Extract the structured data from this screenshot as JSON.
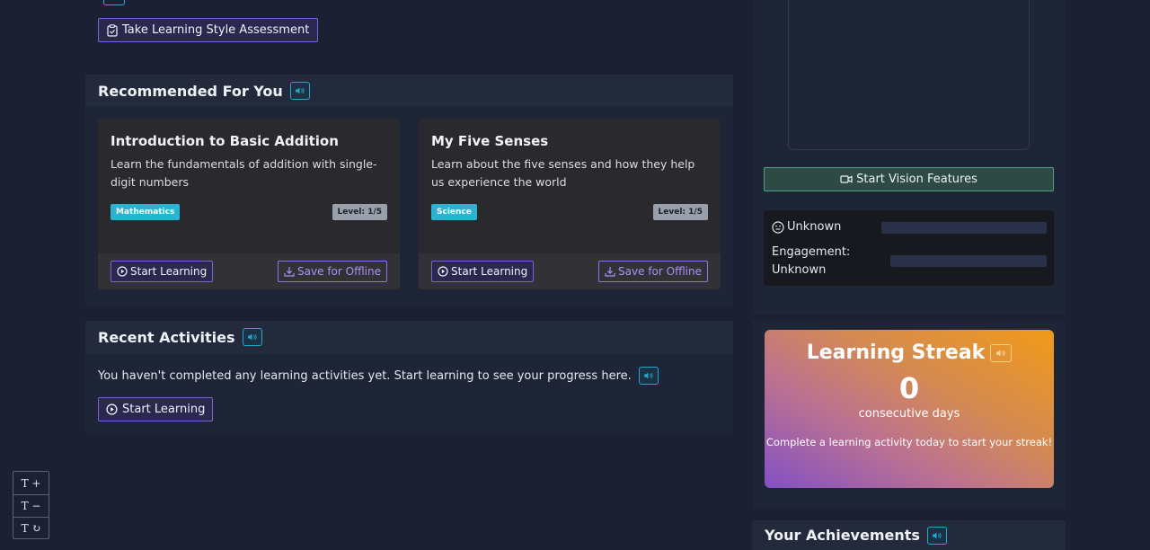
{
  "assessment_button": {
    "label": "Take Learning Style Assessment"
  },
  "recommended": {
    "title": "Recommended For You",
    "cards": [
      {
        "title": "Introduction to Basic Addition",
        "description": "Learn the fundamentals of addition with single-digit numbers",
        "subject": "Mathematics",
        "level": "Level: 1/5",
        "start_label": "Start Learning",
        "offline_label": "Save for Offline"
      },
      {
        "title": "My Five Senses",
        "description": "Learn about the five senses and how they help us experience the world",
        "subject": "Science",
        "level": "Level: 1/5",
        "start_label": "Start Learning",
        "offline_label": "Save for Offline"
      }
    ]
  },
  "recent": {
    "title": "Recent Activities",
    "empty_message": "You haven't completed any learning activities yet. Start learning to see your progress here.",
    "start_label": "Start Learning"
  },
  "vision": {
    "button_label": "Start Vision Features"
  },
  "status": {
    "emotion": "Unknown",
    "engagement_label": "Engagement:",
    "engagement_value": "Unknown"
  },
  "streak": {
    "title": "Learning Streak",
    "count": "0",
    "unit": "consecutive days",
    "message": "Complete a learning activity today to start your streak!"
  },
  "achievements": {
    "title": "Your Achievements"
  },
  "text_tools": {
    "increase": "T +",
    "decrease": "T −",
    "reset": "T ↻"
  },
  "colors": {
    "background": "#1b2132",
    "accent_purple": "#7b63d6",
    "accent_cyan": "#2ab4d2",
    "vision_green": "#4fa07e",
    "streak_start": "#8250c4",
    "streak_end": "#f19a18"
  }
}
